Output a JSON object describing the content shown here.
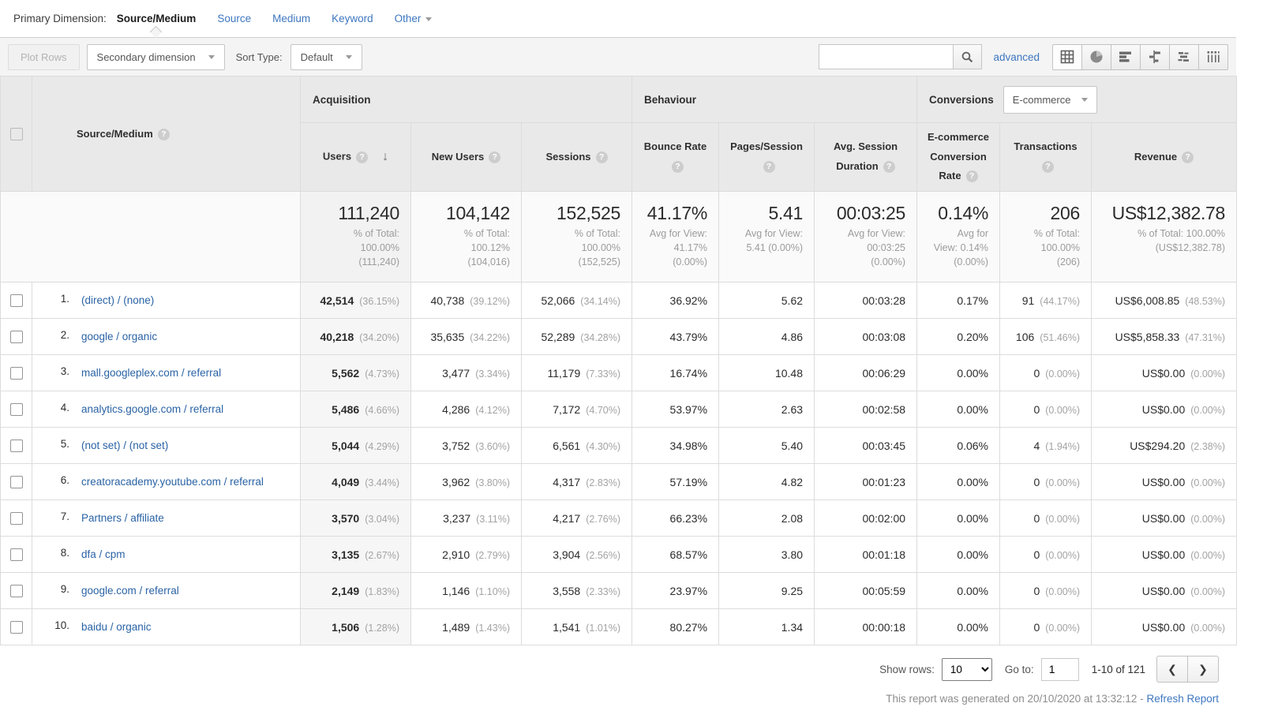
{
  "colors": {
    "link_blue": "#3e77c0",
    "row_link_blue": "#2a63a5",
    "header_gray": "#e9e9e9"
  },
  "primary_dimension": {
    "label": "Primary Dimension:",
    "selected": "Source/Medium",
    "options": [
      "Source",
      "Medium",
      "Keyword"
    ],
    "other_label": "Other"
  },
  "toolbar": {
    "plot_rows_label": "Plot Rows",
    "secondary_dimension_label": "Secondary dimension",
    "sort_type_label": "Sort Type:",
    "sort_type_value": "Default",
    "search_value": "",
    "advanced_label": "advanced",
    "view_icons": [
      "data-table-icon",
      "percentage-pie-icon",
      "performance-bars-icon",
      "comparison-icon",
      "term-cloud-icon",
      "pivot-icon"
    ]
  },
  "table": {
    "dimension_header": "Source/Medium",
    "groups": {
      "acquisition": "Acquisition",
      "behaviour": "Behaviour",
      "conversions": "Conversions",
      "conversions_dropdown": "E-commerce"
    },
    "columns": [
      "Users",
      "New Users",
      "Sessions",
      "Bounce Rate",
      "Pages/Session",
      "Avg. Session Duration",
      "E-commerce Conversion Rate",
      "Transactions",
      "Revenue"
    ],
    "sort_column": "Users",
    "totals": {
      "users": {
        "value": "111,240",
        "sub": "% of Total:\n100.00%\n(111,240)"
      },
      "new_users": {
        "value": "104,142",
        "sub": "% of Total:\n100.12%\n(104,016)"
      },
      "sessions": {
        "value": "152,525",
        "sub": "% of Total:\n100.00%\n(152,525)"
      },
      "bounce_rate": {
        "value": "41.17%",
        "sub": "Avg for View:\n41.17%\n(0.00%)"
      },
      "pages_session": {
        "value": "5.41",
        "sub": "Avg for View:\n5.41 (0.00%)"
      },
      "avg_duration": {
        "value": "00:03:25",
        "sub": "Avg for View:\n00:03:25\n(0.00%)"
      },
      "conv_rate": {
        "value": "0.14%",
        "sub": "Avg for\nView: 0.14%\n(0.00%)"
      },
      "transactions": {
        "value": "206",
        "sub": "% of Total:\n100.00%\n(206)"
      },
      "revenue": {
        "value": "US$12,382.78",
        "sub": "% of Total: 100.00%\n(US$12,382.78)"
      }
    },
    "rows": [
      {
        "index": "1.",
        "source": "(direct) / (none)",
        "users": "42,514",
        "users_pct": "(36.15%)",
        "new_users": "40,738",
        "new_users_pct": "(39.12%)",
        "sessions": "52,066",
        "sessions_pct": "(34.14%)",
        "bounce_rate": "36.92%",
        "pages_session": "5.62",
        "avg_duration": "00:03:28",
        "conv_rate": "0.17%",
        "transactions": "91",
        "transactions_pct": "(44.17%)",
        "revenue": "US$6,008.85",
        "revenue_pct": "(48.53%)"
      },
      {
        "index": "2.",
        "source": "google / organic",
        "users": "40,218",
        "users_pct": "(34.20%)",
        "new_users": "35,635",
        "new_users_pct": "(34.22%)",
        "sessions": "52,289",
        "sessions_pct": "(34.28%)",
        "bounce_rate": "43.79%",
        "pages_session": "4.86",
        "avg_duration": "00:03:08",
        "conv_rate": "0.20%",
        "transactions": "106",
        "transactions_pct": "(51.46%)",
        "revenue": "US$5,858.33",
        "revenue_pct": "(47.31%)"
      },
      {
        "index": "3.",
        "source": "mall.googleplex.com / referral",
        "users": "5,562",
        "users_pct": "(4.73%)",
        "new_users": "3,477",
        "new_users_pct": "(3.34%)",
        "sessions": "11,179",
        "sessions_pct": "(7.33%)",
        "bounce_rate": "16.74%",
        "pages_session": "10.48",
        "avg_duration": "00:06:29",
        "conv_rate": "0.00%",
        "transactions": "0",
        "transactions_pct": "(0.00%)",
        "revenue": "US$0.00",
        "revenue_pct": "(0.00%)"
      },
      {
        "index": "4.",
        "source": "analytics.google.com / referral",
        "users": "5,486",
        "users_pct": "(4.66%)",
        "new_users": "4,286",
        "new_users_pct": "(4.12%)",
        "sessions": "7,172",
        "sessions_pct": "(4.70%)",
        "bounce_rate": "53.97%",
        "pages_session": "2.63",
        "avg_duration": "00:02:58",
        "conv_rate": "0.00%",
        "transactions": "0",
        "transactions_pct": "(0.00%)",
        "revenue": "US$0.00",
        "revenue_pct": "(0.00%)"
      },
      {
        "index": "5.",
        "source": "(not set) / (not set)",
        "users": "5,044",
        "users_pct": "(4.29%)",
        "new_users": "3,752",
        "new_users_pct": "(3.60%)",
        "sessions": "6,561",
        "sessions_pct": "(4.30%)",
        "bounce_rate": "34.98%",
        "pages_session": "5.40",
        "avg_duration": "00:03:45",
        "conv_rate": "0.06%",
        "transactions": "4",
        "transactions_pct": "(1.94%)",
        "revenue": "US$294.20",
        "revenue_pct": "(2.38%)"
      },
      {
        "index": "6.",
        "source": "creatoracademy.youtube.com / referral",
        "users": "4,049",
        "users_pct": "(3.44%)",
        "new_users": "3,962",
        "new_users_pct": "(3.80%)",
        "sessions": "4,317",
        "sessions_pct": "(2.83%)",
        "bounce_rate": "57.19%",
        "pages_session": "4.82",
        "avg_duration": "00:01:23",
        "conv_rate": "0.00%",
        "transactions": "0",
        "transactions_pct": "(0.00%)",
        "revenue": "US$0.00",
        "revenue_pct": "(0.00%)"
      },
      {
        "index": "7.",
        "source": "Partners / affiliate",
        "users": "3,570",
        "users_pct": "(3.04%)",
        "new_users": "3,237",
        "new_users_pct": "(3.11%)",
        "sessions": "4,217",
        "sessions_pct": "(2.76%)",
        "bounce_rate": "66.23%",
        "pages_session": "2.08",
        "avg_duration": "00:02:00",
        "conv_rate": "0.00%",
        "transactions": "0",
        "transactions_pct": "(0.00%)",
        "revenue": "US$0.00",
        "revenue_pct": "(0.00%)"
      },
      {
        "index": "8.",
        "source": "dfa / cpm",
        "users": "3,135",
        "users_pct": "(2.67%)",
        "new_users": "2,910",
        "new_users_pct": "(2.79%)",
        "sessions": "3,904",
        "sessions_pct": "(2.56%)",
        "bounce_rate": "68.57%",
        "pages_session": "3.80",
        "avg_duration": "00:01:18",
        "conv_rate": "0.00%",
        "transactions": "0",
        "transactions_pct": "(0.00%)",
        "revenue": "US$0.00",
        "revenue_pct": "(0.00%)"
      },
      {
        "index": "9.",
        "source": "google.com / referral",
        "users": "2,149",
        "users_pct": "(1.83%)",
        "new_users": "1,146",
        "new_users_pct": "(1.10%)",
        "sessions": "3,558",
        "sessions_pct": "(2.33%)",
        "bounce_rate": "23.97%",
        "pages_session": "9.25",
        "avg_duration": "00:05:59",
        "conv_rate": "0.00%",
        "transactions": "0",
        "transactions_pct": "(0.00%)",
        "revenue": "US$0.00",
        "revenue_pct": "(0.00%)"
      },
      {
        "index": "10.",
        "source": "baidu / organic",
        "users": "1,506",
        "users_pct": "(1.28%)",
        "new_users": "1,489",
        "new_users_pct": "(1.43%)",
        "sessions": "1,541",
        "sessions_pct": "(1.01%)",
        "bounce_rate": "80.27%",
        "pages_session": "1.34",
        "avg_duration": "00:00:18",
        "conv_rate": "0.00%",
        "transactions": "0",
        "transactions_pct": "(0.00%)",
        "revenue": "US$0.00",
        "revenue_pct": "(0.00%)"
      }
    ]
  },
  "pagination": {
    "show_rows_label": "Show rows:",
    "show_rows_value": "10",
    "goto_label": "Go to:",
    "goto_value": "1",
    "range": "1-10 of 121"
  },
  "footer": {
    "generated_text": "This report was generated on 20/10/2020 at 13:32:12 -",
    "refresh_label": "Refresh Report"
  }
}
